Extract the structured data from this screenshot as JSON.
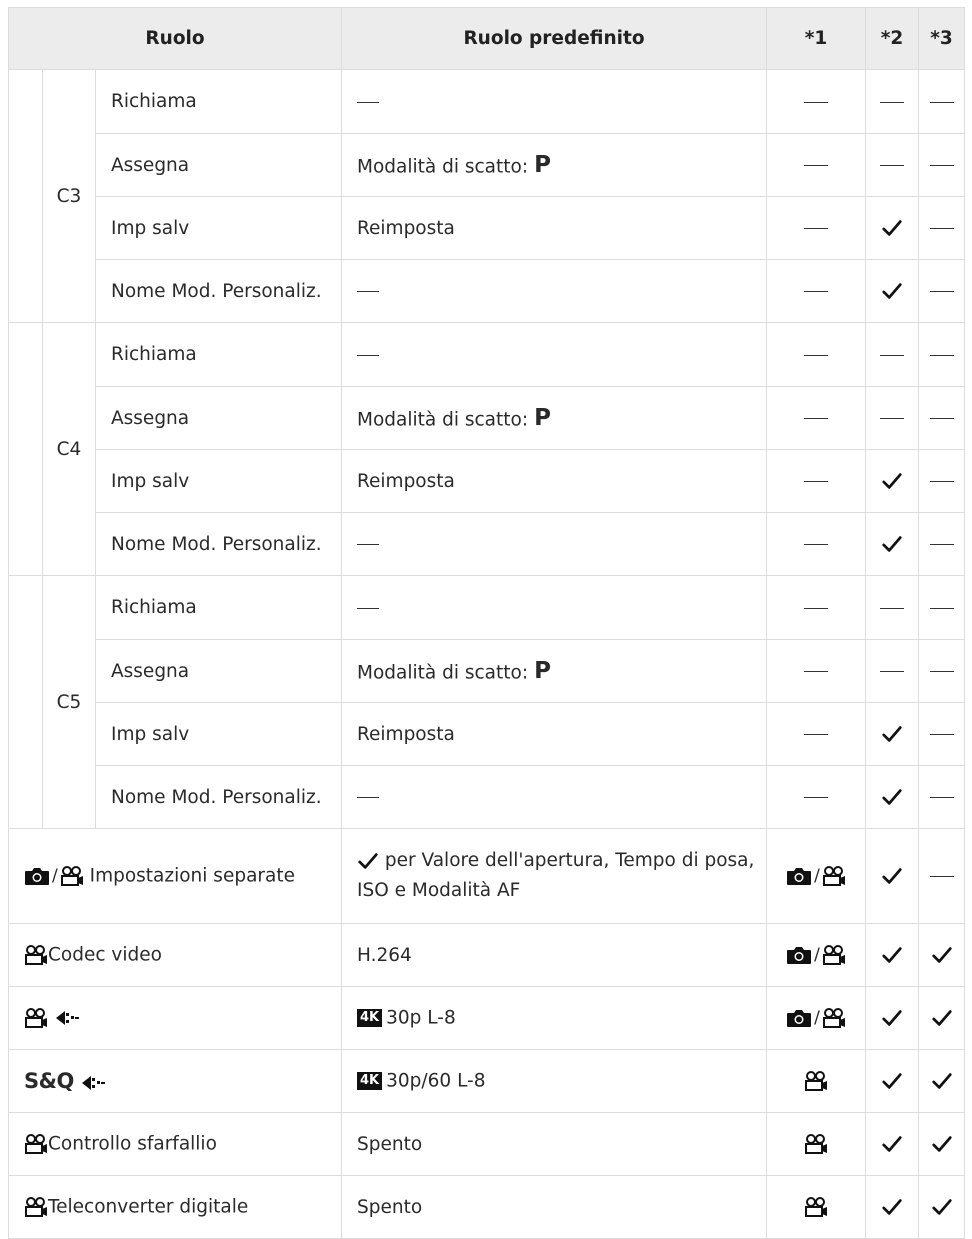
{
  "header": {
    "col_role": "Ruolo",
    "col_default": "Ruolo predefinito",
    "col_n1": "*1",
    "col_n2": "*2",
    "col_n3": "*3"
  },
  "groups": [
    {
      "name": "C3",
      "rows": [
        {
          "label": "Richiama",
          "default": "—",
          "n1": "dash",
          "n2": "dash",
          "n3": "dash"
        },
        {
          "label": "Assegna",
          "default": "Modalità di scatto:",
          "default_strong": "P",
          "n1": "dash",
          "n2": "dash",
          "n3": "dash"
        },
        {
          "label": "Imp salv",
          "default": "Reimposta",
          "n1": "dash",
          "n2": "check",
          "n3": "dash"
        },
        {
          "label": "Nome Mod. Personaliz.",
          "default": "—",
          "n1": "dash",
          "n2": "check",
          "n3": "dash"
        }
      ]
    },
    {
      "name": "C4",
      "rows": [
        {
          "label": "Richiama",
          "default": "—",
          "n1": "dash",
          "n2": "dash",
          "n3": "dash"
        },
        {
          "label": "Assegna",
          "default": "Modalità di scatto:",
          "default_strong": "P",
          "n1": "dash",
          "n2": "dash",
          "n3": "dash"
        },
        {
          "label": "Imp salv",
          "default": "Reimposta",
          "n1": "dash",
          "n2": "check",
          "n3": "dash"
        },
        {
          "label": "Nome Mod. Personaliz.",
          "default": "—",
          "n1": "dash",
          "n2": "check",
          "n3": "dash"
        }
      ]
    },
    {
      "name": "C5",
      "rows": [
        {
          "label": "Richiama",
          "default": "—",
          "n1": "dash",
          "n2": "dash",
          "n3": "dash"
        },
        {
          "label": "Assegna",
          "default": "Modalità di scatto:",
          "default_strong": "P",
          "n1": "dash",
          "n2": "dash",
          "n3": "dash"
        },
        {
          "label": "Imp salv",
          "default": "Reimposta",
          "n1": "dash",
          "n2": "check",
          "n3": "dash"
        },
        {
          "label": "Nome Mod. Personaliz.",
          "default": "—",
          "n1": "dash",
          "n2": "check",
          "n3": "dash"
        }
      ]
    }
  ],
  "rows": [
    {
      "label": "Impostazioni separate",
      "icons": [
        "camera-icon",
        "movie-icon"
      ],
      "default": "per Valore dell'apertura, Tempo di posa, ISO e Modalità AF",
      "default_icon": "check-icon",
      "n1": "camera-movie",
      "n2": "check",
      "n3": "dash"
    },
    {
      "label": "Codec video",
      "icons": [
        "movie-icon"
      ],
      "default": "H.264",
      "n1": "camera-movie",
      "n2": "check",
      "n3": "check"
    },
    {
      "label": "",
      "icons": [
        "movie-icon",
        "image-quality-icon"
      ],
      "default": "30p L-8",
      "default_badge": "4K",
      "n1": "camera-movie",
      "n2": "check",
      "n3": "check"
    },
    {
      "label": "S&Q",
      "icons": [
        "image-quality-icon"
      ],
      "default": "30p/60 L-8",
      "default_badge": "4K",
      "n1": "movie",
      "n2": "check",
      "n3": "check"
    },
    {
      "label": "Controllo sfarfallio",
      "icons": [
        "movie-icon"
      ],
      "default": "Spento",
      "n1": "movie",
      "n2": "check",
      "n3": "check"
    },
    {
      "label": "Teleconverter digitale",
      "icons": [
        "movie-icon"
      ],
      "default": "Spento",
      "n1": "movie",
      "n2": "check",
      "n3": "check"
    }
  ]
}
